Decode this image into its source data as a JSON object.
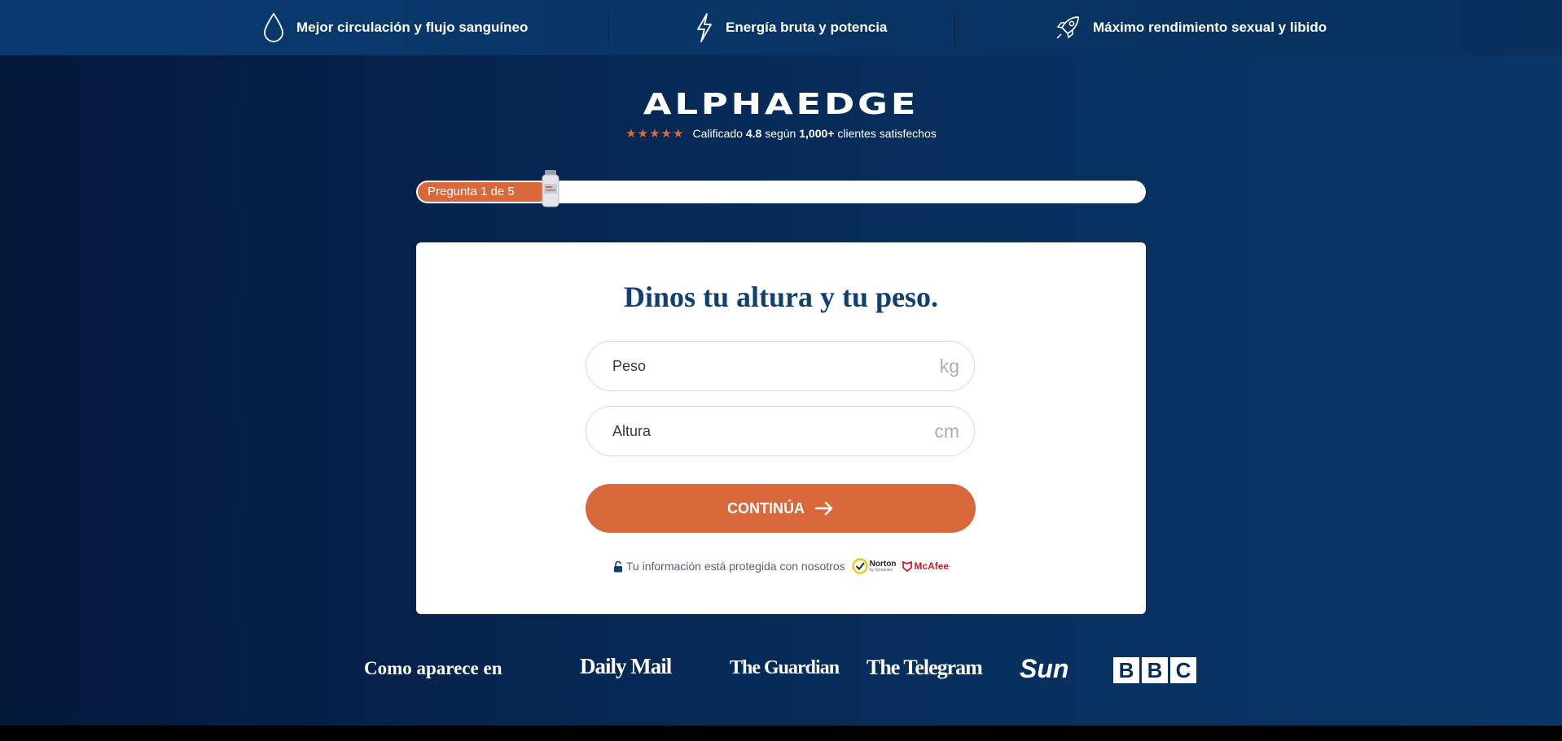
{
  "topbar": {
    "features": [
      {
        "label": "Mejor circulación y flujo sanguíneo",
        "icon": "droplet-icon"
      },
      {
        "label": "Energía bruta y potencia",
        "icon": "lightning-icon"
      },
      {
        "label": "Máximo rendimiento sexual y libido",
        "icon": "rocket-icon"
      }
    ]
  },
  "brand": {
    "logo": "ALPHAEDGE",
    "stars": "★★★★★",
    "rating_prefix": "Calificado",
    "rating_value": "4.8",
    "rating_mid": "según",
    "rating_count": "1,000+",
    "rating_suffix": "clientes satisfechos"
  },
  "progress": {
    "label": "Pregunta 1 de 5",
    "fraction": 0.2
  },
  "form": {
    "title": "Dinos tu altura y tu peso.",
    "weight_placeholder": "Peso",
    "weight_unit": "kg",
    "height_placeholder": "Altura",
    "height_unit": "cm",
    "submit_label": "CONTINÚA",
    "security_text": "Tu información está protegida con nosotros",
    "norton_label": "Norton",
    "norton_sub": "by Symantec",
    "mcafee_label": "McAfee"
  },
  "press": {
    "label": "Como aparece en",
    "outlets": [
      "Daily Mail",
      "The Guardian",
      "The Telegram",
      "Sun",
      "BBC"
    ],
    "bbc_letters": [
      "B",
      "B",
      "C"
    ]
  },
  "colors": {
    "accent": "#d9683a",
    "navy": "#07305f",
    "title": "#103f72"
  }
}
